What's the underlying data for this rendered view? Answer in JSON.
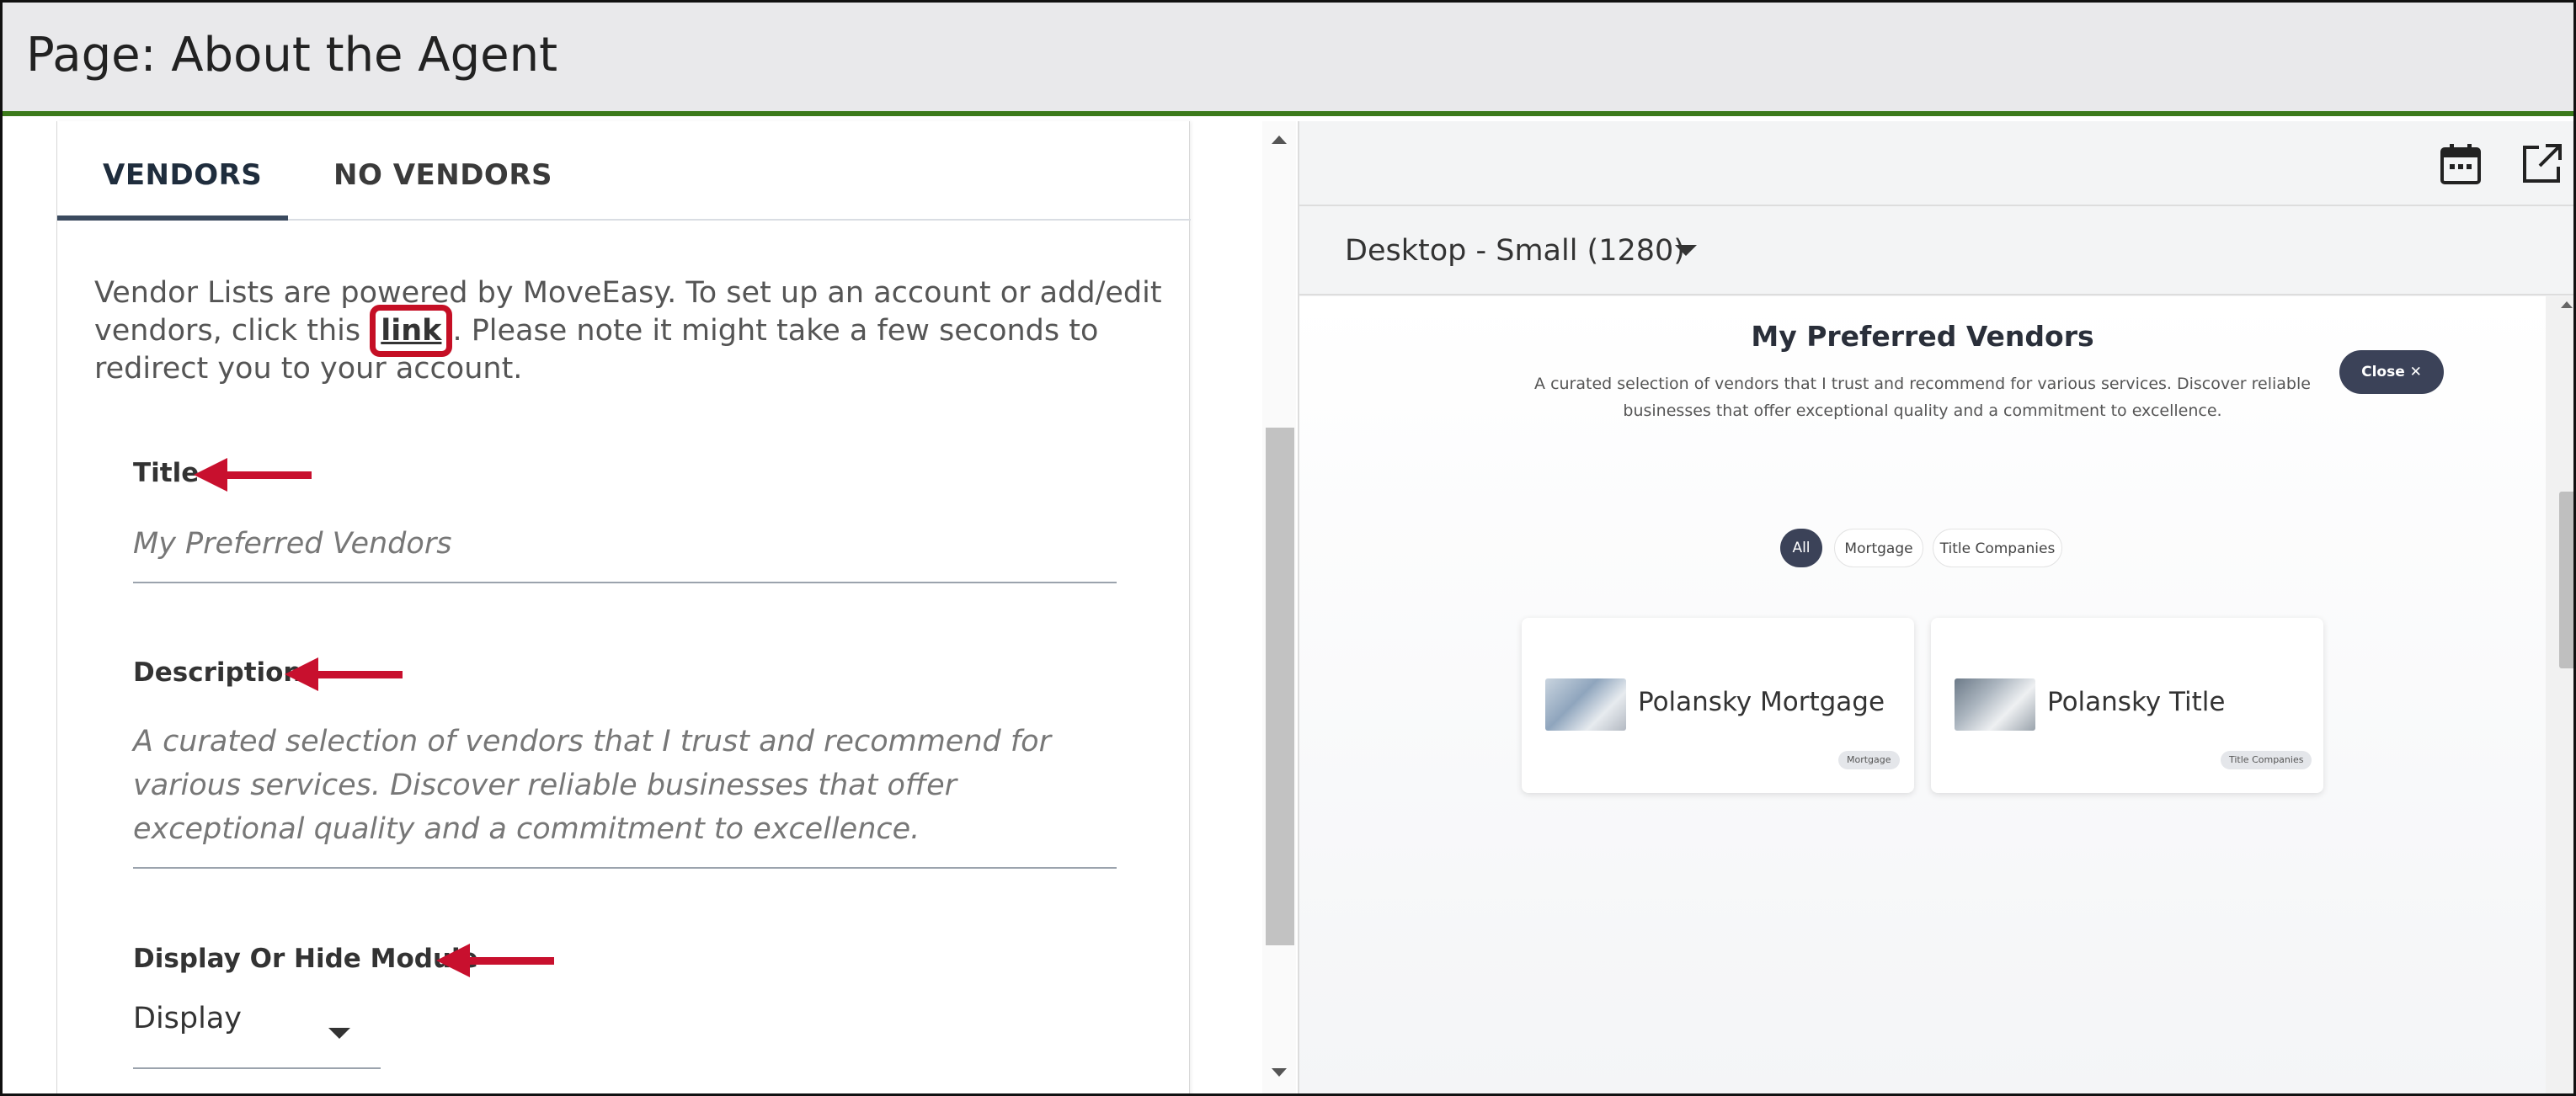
{
  "header": {
    "title": "Page: About the Agent"
  },
  "editor": {
    "tabs": [
      {
        "label": "VENDORS",
        "active": true
      },
      {
        "label": "NO VENDORS",
        "active": false
      }
    ],
    "intro_before": "Vendor Lists are powered by MoveEasy. To set up an account or add/edit vendors, click this ",
    "intro_link": "link",
    "intro_after": ". Please note it might take a few seconds to redirect you to your account.",
    "fields": {
      "title": {
        "label": "Title",
        "value": "My Preferred Vendors"
      },
      "description": {
        "label": "Description",
        "value": "A curated selection of vendors that I trust and recommend for various services. Discover reliable businesses that offer exceptional quality and a commitment to excellence."
      },
      "display": {
        "label": "Display Or Hide Module",
        "value": "Display"
      }
    }
  },
  "preview_panel": {
    "viewport": "Desktop - Small (1280)",
    "icons": [
      "calendar-icon",
      "external-link-icon"
    ],
    "module": {
      "title": "My Preferred Vendors",
      "description": "A curated selection of vendors that I trust and recommend for various services. Discover reliable businesses that offer exceptional quality and a commitment to excellence.",
      "close_label": "Close",
      "filters": [
        "All",
        "Mortgage",
        "Title Companies"
      ],
      "vendors": [
        {
          "name": "Polansky Mortgage",
          "badge": "Mortgage"
        },
        {
          "name": "Polansky Title",
          "badge": "Title Companies"
        }
      ]
    }
  },
  "colors": {
    "header_bg": "#e9e9eb",
    "header_rule": "#3c7a1b",
    "annotation_red": "#c8102e",
    "dark_pill": "#3b4258"
  }
}
